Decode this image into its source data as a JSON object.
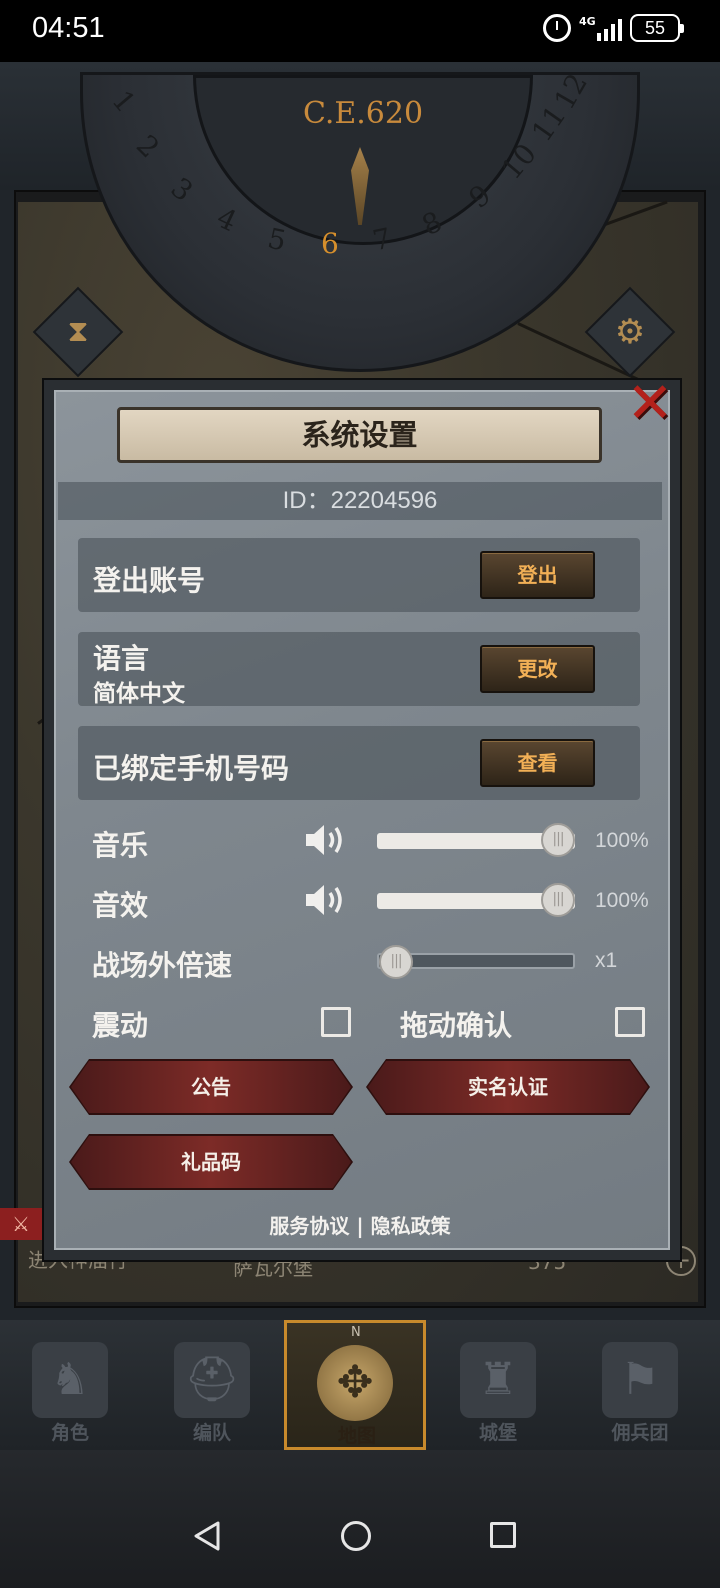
{
  "status_bar": {
    "time": "04:51",
    "network": "4G",
    "battery": "55"
  },
  "dial": {
    "era": "C.E.620",
    "numbers": [
      "1",
      "2",
      "3",
      "4",
      "5",
      "6",
      "7",
      "8",
      "9",
      "10",
      "11",
      "12"
    ]
  },
  "map_strip": {
    "left_text": "进入神庙行",
    "center_text": "萨瓦尔堡",
    "count": "375"
  },
  "dialog": {
    "title": "系统设置",
    "id_text": "ID：22204596",
    "logout": {
      "label": "登出账号",
      "button": "登出"
    },
    "language": {
      "label": "语言",
      "value": "简体中文",
      "button": "更改"
    },
    "phone": {
      "label": "已绑定手机号码",
      "button": "查看"
    },
    "music": {
      "label": "音乐",
      "value": "100%",
      "level": 1.0
    },
    "sfx": {
      "label": "音效",
      "value": "100%",
      "level": 1.0
    },
    "speed": {
      "label": "战场外倍速",
      "value": "x1",
      "level": 0.0
    },
    "vibration": {
      "label": "震动",
      "checked": false
    },
    "drag_confirm": {
      "label": "拖动确认",
      "checked": false
    },
    "announcement": "公告",
    "real_name": "实名认证",
    "gift_code": "礼品码",
    "terms": "服务协议",
    "separator": "|",
    "privacy": "隐私政策"
  },
  "bottom_nav": {
    "items": [
      {
        "label": "角色",
        "icon": "knight-icon"
      },
      {
        "label": "编队",
        "icon": "helmet-icon"
      },
      {
        "label": "地图",
        "icon": "compass-map-icon",
        "compass_letter": "N"
      },
      {
        "label": "城堡",
        "icon": "castle-icon"
      },
      {
        "label": "佣兵团",
        "icon": "mercenary-icon"
      }
    ],
    "active_index": 2
  },
  "colors": {
    "accent_orange": "#f2b056",
    "close_red": "#b3211b",
    "ribbon_red": "#7d2b27",
    "dialog_bg": "#7f878e"
  }
}
